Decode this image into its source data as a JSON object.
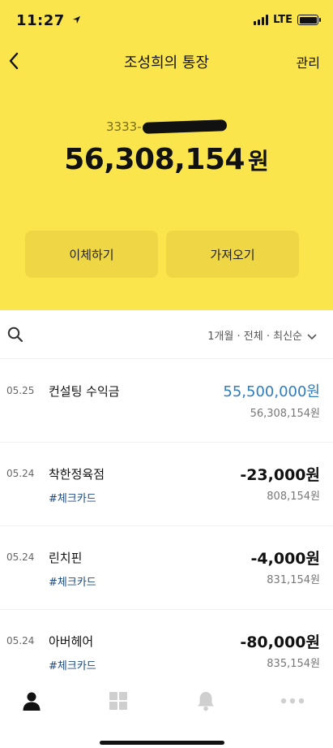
{
  "status_bar": {
    "time": "11:27",
    "network": "LTE"
  },
  "header": {
    "title": "조성희의 통장",
    "manage_label": "관리"
  },
  "account": {
    "number_prefix": "3333-",
    "balance": "56,308,154",
    "currency": "원"
  },
  "actions": {
    "transfer_label": "이체하기",
    "fetch_label": "가져오기"
  },
  "filter": {
    "label": "1개월 · 전체 · 최신순"
  },
  "transactions": [
    {
      "date": "05.25",
      "name": "컨설팅 수익금",
      "tag": "",
      "amount": "55,500,000원",
      "balance": "56,308,154원"
    },
    {
      "date": "05.24",
      "name": "착한정육점",
      "tag": "#체크카드",
      "amount": "-23,000원",
      "balance": "808,154원"
    },
    {
      "date": "05.24",
      "name": "린치핀",
      "tag": "#체크카드",
      "amount": "-4,000원",
      "balance": "831,154원"
    },
    {
      "date": "05.24",
      "name": "아버헤어",
      "tag": "#체크카드",
      "amount": "-80,000원",
      "balance": "835,154원"
    }
  ],
  "colors": {
    "brand_yellow": "#fbe54d",
    "button_yellow": "#efd644",
    "income_blue": "#2e7dbf",
    "tag_blue": "#1c4a82"
  },
  "tabbar": {
    "icons": [
      "person-icon",
      "grid-icon",
      "bell-icon",
      "more-icon"
    ]
  }
}
